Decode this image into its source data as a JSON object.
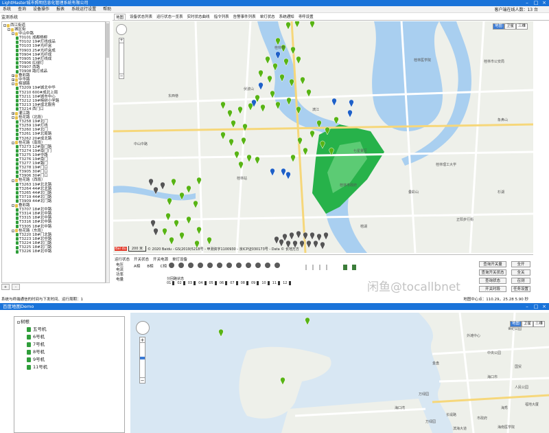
{
  "window1": {
    "title": "LightMaster城市照明信息化管理系统有限公司",
    "menu": [
      "系统",
      "查询",
      "设备操作",
      "报表",
      "系统运行设置",
      "帮助"
    ],
    "client_count": "客户端在线人数：13 台",
    "panel_title": "监测系统",
    "tree": [
      {
        "level": 0,
        "expand": "-",
        "icon": "folder",
        "label": "西江街道"
      },
      {
        "level": 1,
        "expand": "-",
        "icon": "folder",
        "label": "城区街"
      },
      {
        "level": 2,
        "expand": "-",
        "icon": "folder",
        "label": "中山中路"
      },
      {
        "level": 3,
        "expand": "",
        "icon": "lamp",
        "label": "T0101 成都杨柳"
      },
      {
        "level": 3,
        "expand": "",
        "icon": "lamp",
        "label": "T0102 19#灯线成品"
      },
      {
        "level": 3,
        "expand": "",
        "icon": "lamp",
        "label": "T0103 19#光纤盒"
      },
      {
        "level": 3,
        "expand": "",
        "icon": "lamp",
        "label": "T0903 25#光纤盒成"
      },
      {
        "level": 3,
        "expand": "",
        "icon": "lamp",
        "label": "T0904 19#光纤成"
      },
      {
        "level": 3,
        "expand": "",
        "icon": "lamp",
        "label": "T0905 19#灯线成"
      },
      {
        "level": 3,
        "expand": "",
        "icon": "lamp",
        "label": "T0906 红绿灯"
      },
      {
        "level": 3,
        "expand": "",
        "icon": "lamp",
        "label": "T0907 西路"
      },
      {
        "level": 3,
        "expand": "",
        "icon": "lamp",
        "label": "T0908 路灯成品"
      },
      {
        "level": 2,
        "expand": "+",
        "icon": "folder",
        "label": "叠彩路"
      },
      {
        "level": 2,
        "expand": "+",
        "icon": "folder",
        "label": "中华路"
      },
      {
        "level": 2,
        "expand": "-",
        "icon": "folder",
        "label": "榕湖路"
      },
      {
        "level": 3,
        "expand": "",
        "icon": "lamp",
        "label": "T3209 19#城北中华"
      },
      {
        "level": 3,
        "expand": "",
        "icon": "lamp",
        "label": "T3210 600#成北上局"
      },
      {
        "level": 3,
        "expand": "",
        "icon": "lamp",
        "label": "T3211 10#城市中心"
      },
      {
        "level": 3,
        "expand": "",
        "icon": "lamp",
        "label": "T3212 19#榕树小学路"
      },
      {
        "level": 3,
        "expand": "",
        "icon": "lamp",
        "label": "T3213 19#成北服务"
      },
      {
        "level": 3,
        "expand": "",
        "icon": "lamp",
        "label": "T3214 西门口"
      },
      {
        "level": 2,
        "expand": "+",
        "icon": "folder",
        "label": "灌江路"
      },
      {
        "level": 2,
        "expand": "-",
        "icon": "folder",
        "label": "桂花路（北段）"
      },
      {
        "level": 3,
        "expand": "",
        "icon": "lamp",
        "label": "T3258 19#北门"
      },
      {
        "level": 3,
        "expand": "",
        "icon": "lamp",
        "label": "T3259 19#灯线"
      },
      {
        "level": 3,
        "expand": "",
        "icon": "lamp",
        "label": "T3260 19#北门"
      },
      {
        "level": 3,
        "expand": "",
        "icon": "lamp",
        "label": "T3261 19#北局路"
      },
      {
        "level": 3,
        "expand": "",
        "icon": "lamp",
        "label": "T3262 20#成北路"
      },
      {
        "level": 2,
        "expand": "-",
        "icon": "folder",
        "label": "桂花路（南段）"
      },
      {
        "level": 3,
        "expand": "",
        "icon": "lamp",
        "label": "T3273 12#南门路"
      },
      {
        "level": 3,
        "expand": "",
        "icon": "lamp",
        "label": "T3274 19#南门门"
      },
      {
        "level": 3,
        "expand": "",
        "icon": "lamp",
        "label": "T3275 19#中路"
      },
      {
        "level": 3,
        "expand": "",
        "icon": "lamp",
        "label": "T3276 19#南门"
      },
      {
        "level": 3,
        "expand": "",
        "icon": "lamp",
        "label": "T3277 19#路门"
      },
      {
        "level": 3,
        "expand": "",
        "icon": "lamp",
        "label": "T3278 19#门口"
      },
      {
        "level": 3,
        "expand": "",
        "icon": "lamp",
        "label": "T3905 30#门口"
      },
      {
        "level": 3,
        "expand": "",
        "icon": "lamp",
        "label": "T3906 30#门口"
      },
      {
        "level": 2,
        "expand": "-",
        "icon": "folder",
        "label": "桂花路（西段）"
      },
      {
        "level": 3,
        "expand": "",
        "icon": "lamp",
        "label": "T3263 19#北北路"
      },
      {
        "level": 3,
        "expand": "",
        "icon": "lamp",
        "label": "T3264 44#北北路"
      },
      {
        "level": 3,
        "expand": "",
        "icon": "lamp",
        "label": "T3265 44#北门路"
      },
      {
        "level": 3,
        "expand": "",
        "icon": "lamp",
        "label": "T3719 44#北门路"
      },
      {
        "level": 3,
        "expand": "",
        "icon": "lamp",
        "label": "T3909 44#北门路"
      },
      {
        "level": 2,
        "expand": "-",
        "icon": "folder",
        "label": "叠彩路"
      },
      {
        "level": 3,
        "expand": "",
        "icon": "lamp",
        "label": "T3707 18#北中路"
      },
      {
        "level": 3,
        "expand": "",
        "icon": "lamp",
        "label": "T3314 18#北中路"
      },
      {
        "level": 3,
        "expand": "",
        "icon": "lamp",
        "label": "T3315 18#北中路"
      },
      {
        "level": 3,
        "expand": "",
        "icon": "lamp",
        "label": "T3316 18#北中路"
      },
      {
        "level": 3,
        "expand": "",
        "icon": "lamp",
        "label": "T3305 18#北中路"
      },
      {
        "level": 2,
        "expand": "-",
        "icon": "folder",
        "label": "桂花路（东段）"
      },
      {
        "level": 3,
        "expand": "",
        "icon": "lamp",
        "label": "T3220 18#门北路"
      },
      {
        "level": 3,
        "expand": "",
        "icon": "lamp",
        "label": "T3223 18#北中路"
      },
      {
        "level": 3,
        "expand": "",
        "icon": "lamp",
        "label": "T3224 18#北门路"
      },
      {
        "level": 3,
        "expand": "",
        "icon": "lamp",
        "label": "T3225 18#北门路"
      },
      {
        "level": 3,
        "expand": "",
        "icon": "lamp",
        "label": "T3226 18#北中路"
      }
    ],
    "tree_buttons": [
      "+",
      "-"
    ],
    "main_tabs": [
      "地图",
      "设备状态列表",
      "运行状态一览表",
      "实时状态曲线",
      "指令列表",
      "告警事件列表",
      "单灯状态",
      "系统通知",
      "寻呼设置"
    ],
    "map_types": [
      "地图",
      "卫星",
      "三维"
    ],
    "map_labels": [
      "桂林市",
      "桂林医学院",
      "桂林市公安局",
      "东西巷",
      "七星景区",
      "桂林理工大学",
      "象鼻山",
      "桂林站",
      "桂林市政府",
      "正阳步行街",
      "中山中路",
      "叠彩山",
      "伏波山",
      "漓江",
      "榕湖",
      "杉湖"
    ],
    "scale_text": "200 米",
    "copyright": "© 2020 Baidu - GS(2019)5218号 - 甲测资字1100930 - 京ICP证030173号 - Data © 长地万方",
    "bottom_tabs": [
      "运行状态",
      "开关状态",
      "开关电源",
      "单灯设备"
    ],
    "lamp_row_labels": [
      "电压",
      "电流",
      "功率",
      "电量"
    ],
    "loop_header": [
      "A相",
      "B相",
      "C相"
    ],
    "loop_numbers": [
      "01",
      "02",
      "03",
      "04",
      "05",
      "06",
      "07",
      "08",
      "09",
      "10",
      "11",
      "12"
    ],
    "switch_label": "分回路状态",
    "buttons": [
      "查询开关量",
      "全开",
      "查询开关状态",
      "全关",
      "查询状态",
      "召测",
      "开关时段",
      "任务设置"
    ],
    "status_text": "系统与终端通信的时间与下发时间、运行周期：1",
    "coord_text": "地图中心点：110.29，25.28  5.90 秒",
    "watermark": "闲鱼@tocallbnet"
  },
  "window2": {
    "title": "百度地图Demo",
    "tree_root": "树根",
    "tree_items": [
      "五号机",
      "6号机",
      "7号机",
      "8号机",
      "9号机",
      "11号机"
    ],
    "map_types": [
      "地图",
      "卫星",
      "三维"
    ],
    "map_labels": [
      "外滩中心",
      "海口市",
      "长堤路",
      "中央公园",
      "海口湾",
      "万绿园",
      "世纪公园",
      "市政府",
      "金盘",
      "人民公园",
      "海秀",
      "滨海大道",
      "国贸",
      "万绿园",
      "海南医学院",
      "福地大厦"
    ]
  },
  "colors": {
    "titlebar": "#1a73d9",
    "pin_green": "#58b414",
    "pin_blue": "#1e60c8",
    "pin_gray": "#555555",
    "park_green": "#27b24a"
  }
}
